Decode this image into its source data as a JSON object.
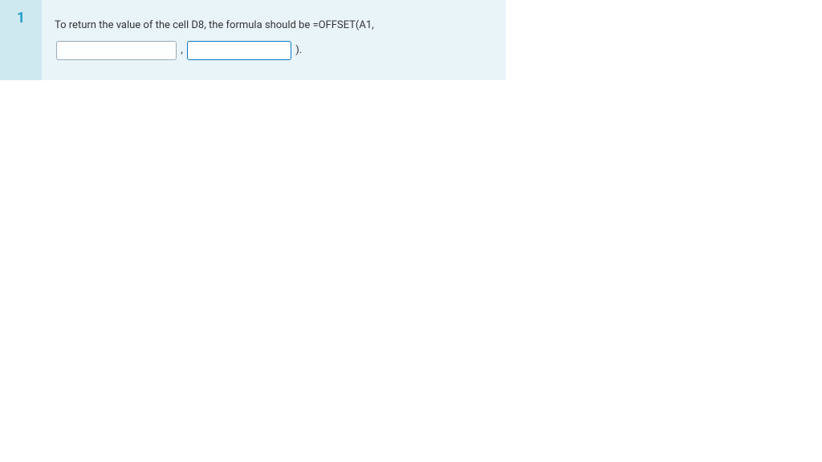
{
  "question": {
    "number": "1",
    "text_before": "To return the value of the cell D8, the formula should be =OFFSET(A1,",
    "input1_value": "",
    "text_mid": ",",
    "input2_value": "",
    "text_after": ")."
  }
}
